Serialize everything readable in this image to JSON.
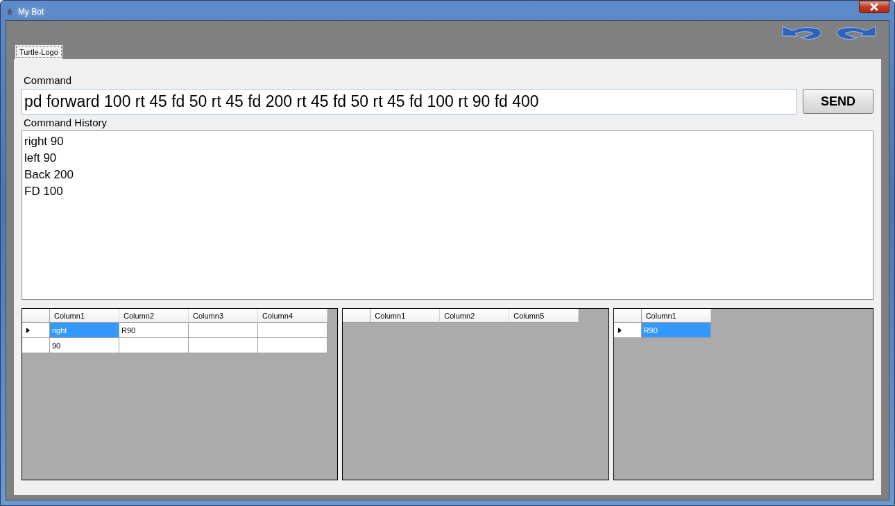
{
  "window": {
    "title": "My Bot"
  },
  "tabs": [
    {
      "label": "Turtle-Logo",
      "selected": true
    }
  ],
  "command": {
    "label": "Command",
    "value": "pd forward 100 rt 45 fd 50 rt 45 fd 200 rt 45 fd 50 rt 45 fd 100 rt 90 fd 400",
    "button": "SEND"
  },
  "history": {
    "label": "Command History",
    "items": [
      "right 90",
      "left 90",
      "Back 200",
      "FD 100"
    ]
  },
  "grids": [
    {
      "columns": [
        "Column1",
        "Column2",
        "Column3",
        "Column4"
      ],
      "rows": [
        {
          "current": true,
          "cells": [
            {
              "text": "right",
              "selected": true
            },
            {
              "text": "R90",
              "selected": false
            },
            {
              "selected": false
            },
            {
              "selected": false
            }
          ]
        },
        {
          "current": false,
          "cells": [
            {
              "text": "90",
              "selected": false
            },
            {
              "selected": false
            },
            {
              "selected": false
            },
            {
              "selected": false
            }
          ]
        }
      ]
    },
    {
      "columns": [
        "Column1",
        "Column2",
        "Column5"
      ]
    },
    {
      "columns": [
        "Column1"
      ],
      "rows": [
        {
          "current": true,
          "cells": [
            {
              "text": "R90",
              "selected": true
            }
          ]
        }
      ]
    }
  ]
}
